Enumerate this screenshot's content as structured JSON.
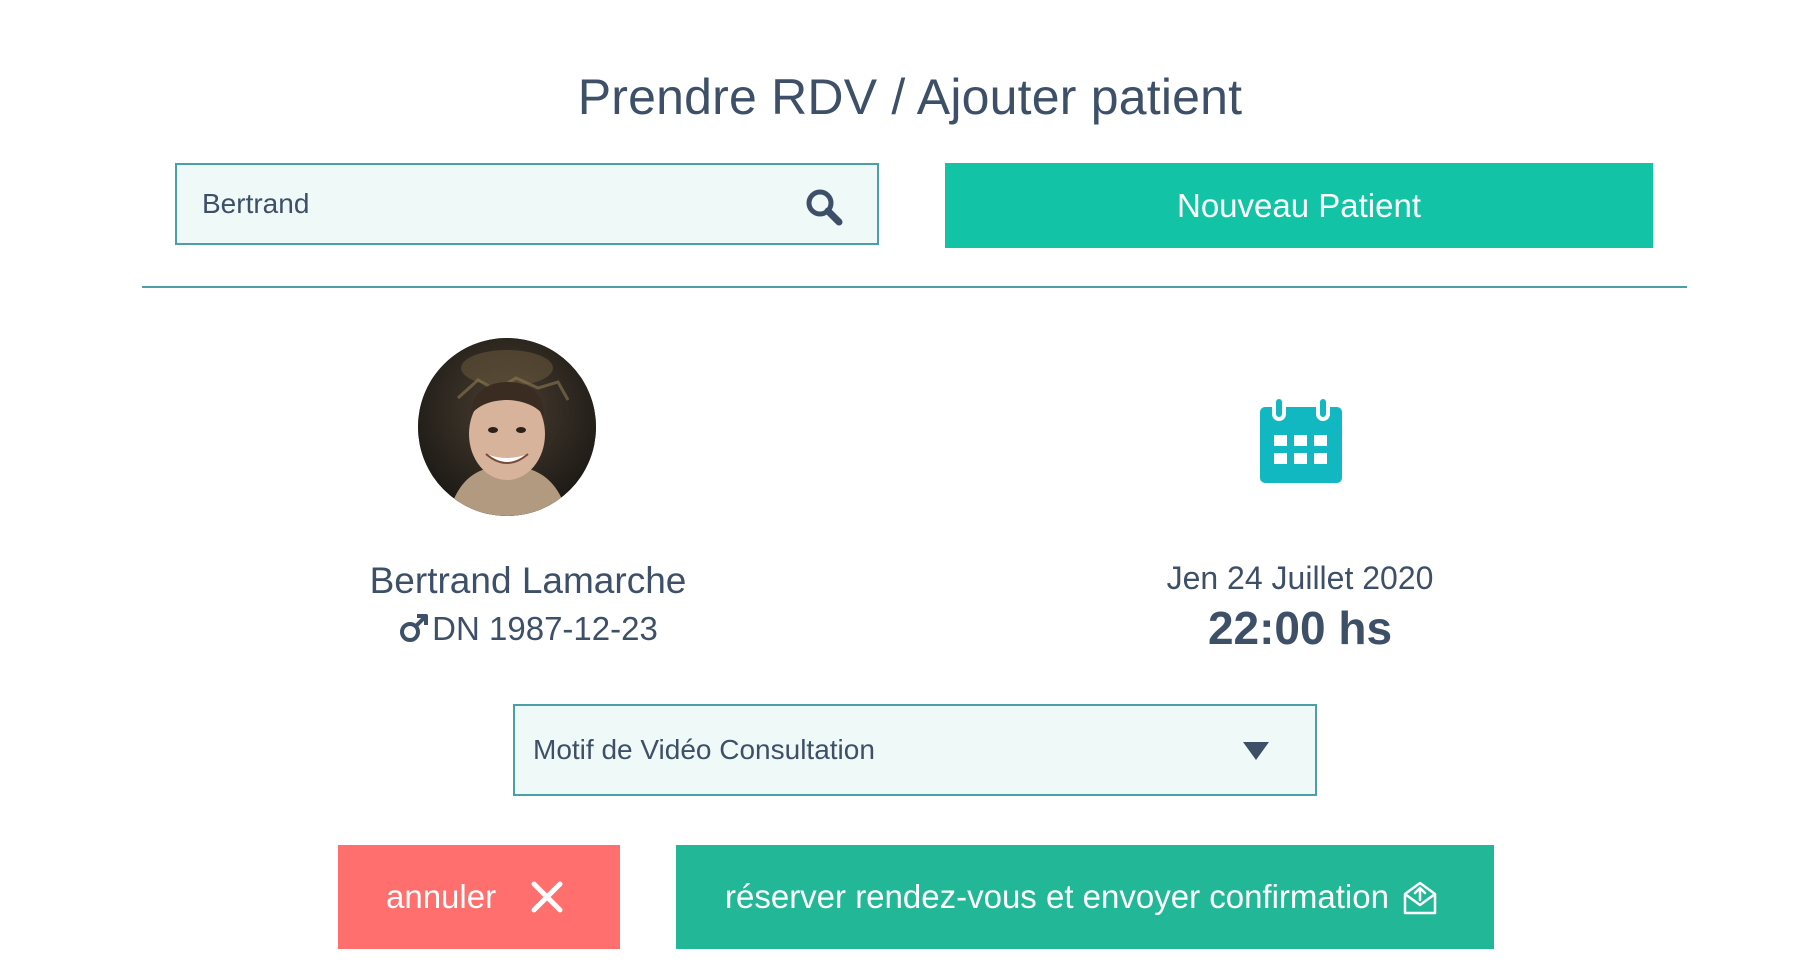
{
  "page": {
    "title": "Prendre RDV / Ajouter patient"
  },
  "search": {
    "value": "Bertrand",
    "icon": "search-icon"
  },
  "actions": {
    "new_patient_label": "Nouveau Patient",
    "cancel_label": "annuler",
    "reserve_label": "réserver rendez-vous et envoyer confirmation"
  },
  "patient": {
    "name": "Bertrand Lamarche",
    "dob": "DN 1987-12-23",
    "gender_icon": "male-icon"
  },
  "appointment": {
    "date": "Jen 24 Juillet 2020",
    "time": "22:00 hs",
    "icon": "calendar-icon"
  },
  "motif": {
    "selected": "Motif de Vidéo Consultation"
  },
  "colors": {
    "primary_green": "#12c4a5",
    "reserve_green": "#22b796",
    "cancel_red": "#fe6f6d",
    "calendar_teal": "#12b8c1",
    "text": "#3d5068",
    "border": "#4a9fa8",
    "field_bg": "#eef9f8"
  }
}
